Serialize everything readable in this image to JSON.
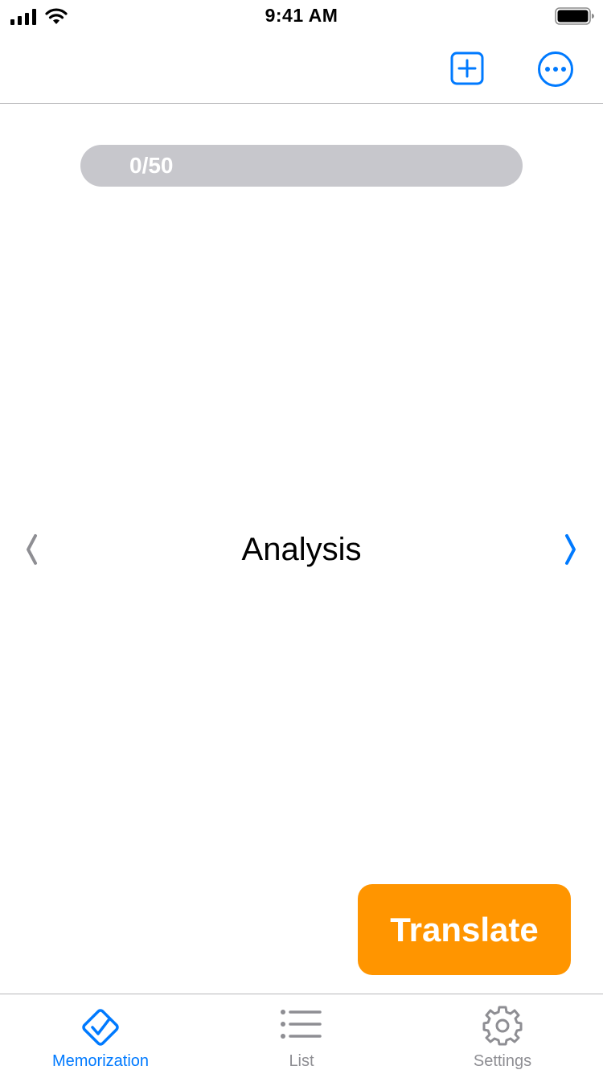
{
  "status_bar": {
    "time": "9:41 AM"
  },
  "nav": {
    "add_icon": "plus-square-icon",
    "more_icon": "ellipsis-circle-icon"
  },
  "progress": {
    "label": "0/50",
    "current": 0,
    "total": 50
  },
  "card": {
    "word": "Analysis",
    "prev_icon": "chevron-left-icon",
    "next_icon": "chevron-right-icon"
  },
  "translate_button": {
    "label": "Translate"
  },
  "tab_bar": {
    "tabs": [
      {
        "label": "Memorization",
        "icon": "checkmark-diamond-icon",
        "selected": true
      },
      {
        "label": "List",
        "icon": "list-bullet-icon",
        "selected": false
      },
      {
        "label": "Settings",
        "icon": "gear-icon",
        "selected": false
      }
    ]
  },
  "colors": {
    "accent": "#007aff",
    "translate": "#ff9500",
    "progress_track": "#c7c7cc",
    "inactive": "#8e8e93"
  }
}
